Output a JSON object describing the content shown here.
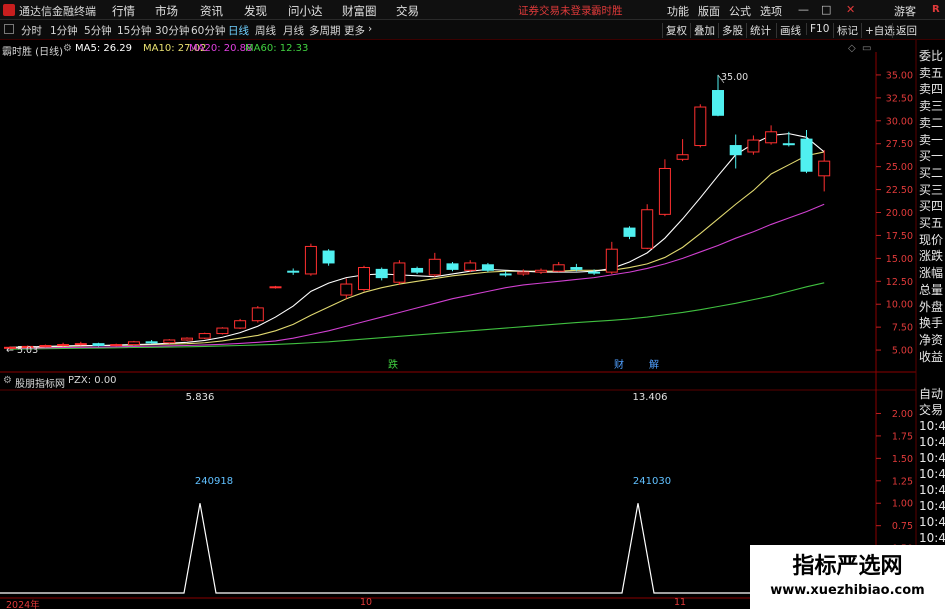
{
  "titlebar": {
    "app_title": "通达信金融终端",
    "menus": [
      "行情",
      "市场",
      "资讯",
      "发现",
      "问小达",
      "财富圈",
      "交易"
    ],
    "warning": "证券交易未登录",
    "stock_name": "霸时胜",
    "right_menus": [
      "功能",
      "版面",
      "公式",
      "选项"
    ],
    "user": "游客",
    "badge": "R"
  },
  "toolbar": {
    "periods": [
      "分时",
      "1分钟",
      "5分钟",
      "15分钟",
      "30分钟",
      "60分钟",
      "日线",
      "周线",
      "月线",
      "多周期",
      "更多"
    ],
    "active": "日线",
    "right_buttons": [
      "复权",
      "叠加",
      "多股",
      "统计",
      "画线",
      "F10",
      "标记",
      "+自选",
      "返回"
    ]
  },
  "chart_header": {
    "title": "霸时胜 (日线)",
    "ma": [
      {
        "label": "MA5: 26.29",
        "color": "#ffffff"
      },
      {
        "label": "MA10: 27.02",
        "color": "#e8e070"
      },
      {
        "label": "MA20: 20.88",
        "color": "#e040e0"
      },
      {
        "label": "MA60: 12.33",
        "color": "#40d040"
      }
    ]
  },
  "indicator_header": {
    "title": "股朋指标网",
    "value": "PZX: 0.00"
  },
  "right_panel": [
    "委比",
    "卖五",
    "卖四",
    "卖三",
    "卖二",
    "卖一",
    "买一",
    "买二",
    "买三",
    "买四",
    "买五",
    "现价",
    "涨跌",
    "涨幅",
    "总量",
    "外盘",
    "换手",
    "净资",
    "收益"
  ],
  "right_panel_lower": [
    "自动",
    "交易",
    "10:40",
    "10:40",
    "10:40",
    "10:40",
    "10:40",
    "10:40",
    "10:40",
    "10:40",
    "10:40"
  ],
  "annotations": {
    "high": "35.00",
    "low": "5.03",
    "value1": "5.836",
    "value2": "13.406",
    "date1": "240918",
    "date2": "241030",
    "mark1": "跌",
    "mark2": "财",
    "mark3": "解"
  },
  "x_labels": [
    "2024年",
    "10",
    "11"
  ],
  "ad": {
    "line1": "指标严选网",
    "line2": "www.xuezhibiao.com"
  },
  "chart_data": [
    {
      "type": "candlestick",
      "y_ticks": [
        "35.00",
        "32.50",
        "30.00",
        "27.50",
        "25.00",
        "22.50",
        "20.00",
        "17.50",
        "15.00",
        "12.50",
        "10.00",
        "7.50",
        "5.00"
      ],
      "ylim": [
        3.7,
        37.5
      ],
      "candles": [
        [
          5.2,
          5.4,
          5.1,
          5.3
        ],
        [
          5.3,
          5.5,
          5.2,
          5.4
        ],
        [
          5.4,
          5.6,
          5.3,
          5.5
        ],
        [
          5.5,
          5.8,
          5.4,
          5.6
        ],
        [
          5.6,
          5.9,
          5.5,
          5.7
        ],
        [
          5.7,
          5.8,
          5.4,
          5.5
        ],
        [
          5.5,
          5.7,
          5.4,
          5.6
        ],
        [
          5.6,
          6.0,
          5.5,
          5.9
        ],
        [
          5.9,
          6.1,
          5.7,
          5.8
        ],
        [
          5.8,
          6.2,
          5.7,
          6.1
        ],
        [
          6.1,
          6.4,
          6.0,
          6.3
        ],
        [
          6.3,
          6.9,
          6.2,
          6.8
        ],
        [
          6.8,
          7.5,
          6.7,
          7.4
        ],
        [
          7.4,
          8.4,
          7.3,
          8.2
        ],
        [
          8.2,
          9.8,
          8.0,
          9.6
        ],
        [
          11.8,
          12.0,
          11.7,
          11.9
        ],
        [
          13.6,
          13.9,
          13.2,
          13.5
        ],
        [
          13.3,
          16.6,
          13.1,
          16.3
        ],
        [
          15.8,
          16.0,
          14.2,
          14.5
        ],
        [
          11.0,
          12.8,
          10.6,
          12.2
        ],
        [
          11.6,
          14.2,
          11.4,
          14.0
        ],
        [
          13.8,
          14.0,
          12.6,
          12.9
        ],
        [
          12.4,
          14.8,
          12.1,
          14.5
        ],
        [
          13.9,
          14.1,
          13.3,
          13.5
        ],
        [
          13.2,
          15.6,
          13.0,
          14.9
        ],
        [
          14.4,
          14.6,
          13.6,
          13.8
        ],
        [
          13.7,
          14.8,
          13.5,
          14.5
        ],
        [
          14.3,
          14.5,
          13.5,
          13.7
        ],
        [
          13.3,
          13.6,
          13.0,
          13.2
        ],
        [
          13.3,
          13.8,
          13.1,
          13.5
        ],
        [
          13.5,
          13.9,
          13.3,
          13.7
        ],
        [
          13.6,
          14.6,
          13.5,
          14.3
        ],
        [
          14.0,
          14.4,
          13.6,
          13.8
        ],
        [
          13.5,
          13.8,
          13.2,
          13.4
        ],
        [
          13.5,
          16.8,
          13.3,
          16.0
        ],
        [
          18.3,
          18.5,
          17.1,
          17.4
        ],
        [
          16.1,
          20.9,
          16.0,
          20.3
        ],
        [
          19.8,
          25.8,
          19.6,
          24.8
        ],
        [
          25.8,
          28.0,
          25.6,
          26.3
        ],
        [
          27.3,
          31.8,
          27.1,
          31.5
        ],
        [
          33.3,
          35.0,
          30.5,
          30.6
        ],
        [
          27.3,
          28.5,
          24.8,
          26.3
        ],
        [
          26.6,
          28.4,
          26.3,
          27.9
        ],
        [
          27.6,
          29.5,
          27.4,
          28.8
        ],
        [
          27.5,
          28.8,
          27.2,
          27.4
        ],
        [
          28.0,
          29.0,
          24.3,
          24.5
        ],
        [
          24.0,
          26.8,
          22.3,
          25.6
        ]
      ],
      "ma5": [
        5.3,
        5.35,
        5.4,
        5.45,
        5.5,
        5.5,
        5.55,
        5.6,
        5.65,
        5.75,
        5.85,
        6.05,
        6.4,
        6.9,
        7.6,
        8.6,
        9.8,
        11.4,
        12.3,
        12.9,
        13.2,
        13.3,
        13.2,
        13.1,
        13.0,
        13.3,
        13.6,
        13.8,
        13.7,
        13.6,
        13.5,
        13.5,
        13.5,
        13.6,
        13.9,
        14.6,
        15.6,
        17.2,
        19.3,
        21.6,
        24.0,
        26.3,
        27.5,
        28.4,
        28.6,
        28.2,
        26.6
      ],
      "ma10": [
        5.25,
        5.3,
        5.35,
        5.4,
        5.45,
        5.5,
        5.5,
        5.55,
        5.6,
        5.65,
        5.7,
        5.8,
        6.0,
        6.3,
        6.6,
        7.1,
        7.8,
        8.8,
        9.7,
        10.6,
        11.3,
        11.8,
        12.2,
        12.5,
        12.8,
        13.1,
        13.3,
        13.5,
        13.6,
        13.6,
        13.6,
        13.6,
        13.7,
        13.7,
        13.7,
        14.0,
        14.4,
        15.1,
        16.2,
        17.7,
        19.3,
        20.9,
        22.4,
        24.2,
        25.2,
        26.2,
        26.6
      ],
      "ma20": [
        5.2,
        5.22,
        5.25,
        5.28,
        5.3,
        5.33,
        5.36,
        5.4,
        5.43,
        5.47,
        5.5,
        5.56,
        5.63,
        5.72,
        5.85,
        6.0,
        6.3,
        6.7,
        7.1,
        7.6,
        8.1,
        8.6,
        9.1,
        9.6,
        10.1,
        10.6,
        11.0,
        11.4,
        11.8,
        12.1,
        12.3,
        12.5,
        12.7,
        12.9,
        13.2,
        13.5,
        13.9,
        14.4,
        15.0,
        15.7,
        16.4,
        17.2,
        17.9,
        18.7,
        19.4,
        20.1,
        20.9
      ],
      "ma60": [
        5.1,
        5.12,
        5.15,
        5.18,
        5.2,
        5.22,
        5.25,
        5.28,
        5.3,
        5.33,
        5.36,
        5.4,
        5.45,
        5.5,
        5.56,
        5.62,
        5.7,
        5.8,
        5.9,
        6.05,
        6.2,
        6.35,
        6.5,
        6.65,
        6.8,
        6.95,
        7.1,
        7.25,
        7.4,
        7.55,
        7.7,
        7.85,
        8.0,
        8.12,
        8.25,
        8.4,
        8.6,
        8.85,
        9.1,
        9.4,
        9.75,
        10.1,
        10.5,
        10.9,
        11.4,
        11.9,
        12.33
      ]
    },
    {
      "type": "line",
      "name": "PZX",
      "y_ticks": [
        "2.00",
        "1.75",
        "1.50",
        "1.25",
        "1.00",
        "0.75",
        "0.50",
        "0.25"
      ],
      "ylim": [
        0,
        2.15
      ],
      "spikes": [
        {
          "index": 10,
          "value": 1
        },
        {
          "index": 35,
          "value": 1
        }
      ]
    }
  ]
}
